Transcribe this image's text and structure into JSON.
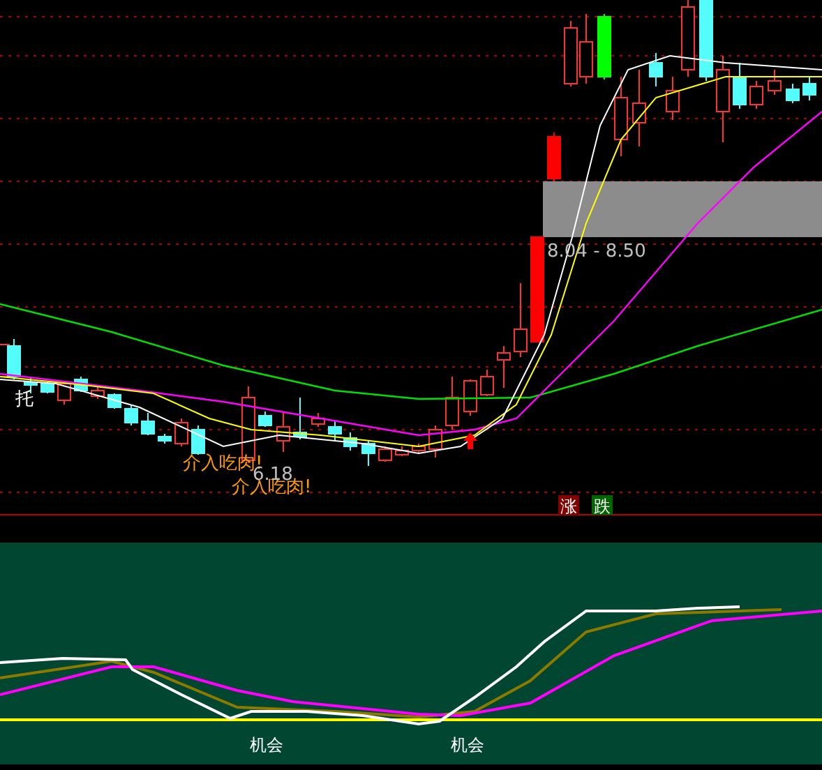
{
  "price_panel": {
    "series_label": "托",
    "signals": [
      {
        "text": "介入吃肉!"
      },
      {
        "text": "介入吃肉!"
      }
    ],
    "price_markers": [
      "6.18",
      "8.04 - 8.50"
    ],
    "legend": [
      {
        "text": "涨",
        "color": "#800000"
      },
      {
        "text": "跌",
        "color": "#006400"
      }
    ]
  },
  "indicator_panel": {
    "signals": [
      "机会",
      "机会"
    ]
  }
}
